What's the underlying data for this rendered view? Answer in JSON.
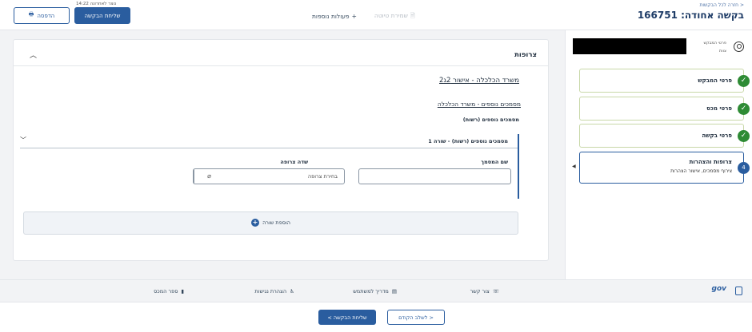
{
  "header": {
    "breadcrumb": "< חזרה לכל הבקשות",
    "title": "בקשה אחודה: 166751",
    "more_actions": "פעולות נוספות",
    "save_draft": "שמירת טיוטה",
    "print": "הדפסה",
    "send_request": "שליחת הבקשה",
    "request_number_note": "נוצר לאחרונה 14:22"
  },
  "sidebar": {
    "user_label_1": "פרטי המבקש",
    "user_label_2": "צוות",
    "steps": [
      {
        "label": "פרטי המבקש",
        "status": "done"
      },
      {
        "label": "פרטי מכס",
        "status": "done"
      },
      {
        "label": "פרטי בקשה",
        "status": "done"
      },
      {
        "label": "צרופות והצהרות",
        "sub": "צירוף מסמכים, אישור הצהרות",
        "number": "4",
        "status": "active"
      }
    ]
  },
  "card": {
    "title": "צרופות",
    "section_title": "משרד הכלכלה - אישור 2ג2",
    "subsection_title": "מסמכים נוספים - משרד הכלכלה",
    "subsub_title": "מסמכים נוספים (רשות)",
    "row_title": "מסמכים נוספים (רשות) - שורה 1",
    "label_docname": "שם המסמך",
    "label_attach": "שדה צרופה",
    "attach_placeholder": "בחירת צרופה",
    "add_row": "הוספת שורה"
  },
  "footer": {
    "contact": "צור קשר",
    "user_guide": "מדריך למשתמש",
    "accessibility": "הצהרת נגישות",
    "customs_book": "ספר המכס",
    "gov": "gov"
  },
  "nav": {
    "prev": "< לשלב הקודם",
    "send": "שליחת הבקשה >"
  },
  "colors": {
    "primary": "#2a5d9f",
    "success": "#2e8b34"
  }
}
